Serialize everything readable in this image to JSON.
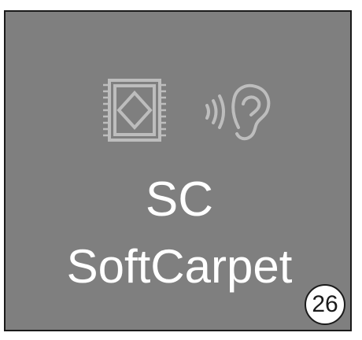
{
  "tile": {
    "code": "SC",
    "name": "SoftCarpet",
    "page_number": "26",
    "icons": [
      "soft-carpet-rug-icon",
      "acoustic-ear-icon"
    ]
  },
  "colors": {
    "tile_background": "#7f7f7f",
    "icon_stroke": "#bdbdbd",
    "text": "#ffffff",
    "border": "#1a1a1a"
  }
}
